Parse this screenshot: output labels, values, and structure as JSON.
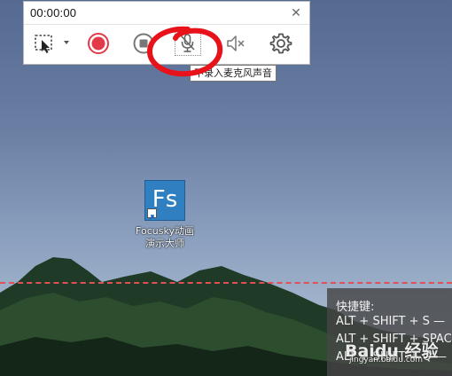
{
  "toolbar": {
    "timer": "00:00:00",
    "close_icon": "close-icon",
    "buttons": [
      {
        "name": "region-select-icon"
      },
      {
        "name": "dropdown-arrow-icon"
      },
      {
        "name": "record-icon",
        "color": "#e23a48"
      },
      {
        "name": "stop-icon"
      },
      {
        "name": "microphone-muted-icon"
      },
      {
        "name": "speaker-muted-icon"
      },
      {
        "name": "settings-gear-icon"
      }
    ],
    "tooltip": "不录入麦克风声音",
    "annotation_color": "#e8121a"
  },
  "desktop": {
    "icon_text": "Fs",
    "icon_color": "#2f7fc1",
    "icon_label_line1": "Focusky动画",
    "icon_label_line2": "演示大师"
  },
  "dashed_line_color": "#e05055",
  "hotkeys": {
    "title": "快捷键:",
    "line1": "ALT + SHIFT + S —",
    "line2": "ALT + SHIFT + SPAC",
    "line3": "ALT + SHIFT + Q —"
  },
  "watermark": {
    "text": "Baidu 经验",
    "url": "jingyan.baidu.com"
  }
}
